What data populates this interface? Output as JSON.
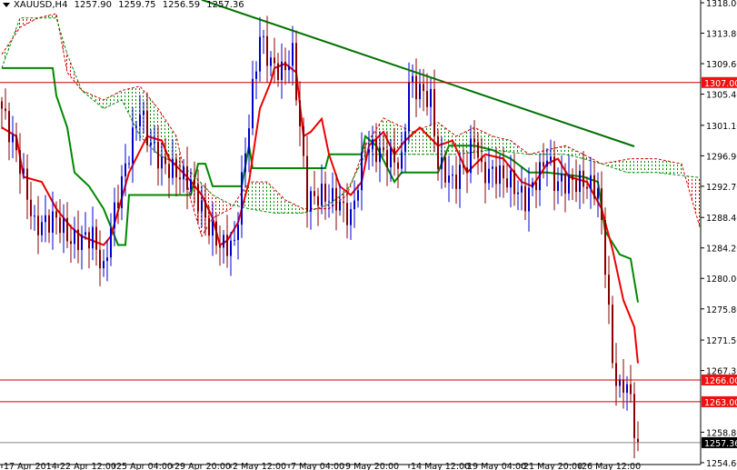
{
  "header": {
    "symbol": "XAUUSD,H4",
    "open": "1257.90",
    "high": "1259.75",
    "low": "1256.59",
    "close": "1257.36"
  },
  "colors": {
    "bull": "#0000cc",
    "bear": "#880000",
    "tenkan": "#ee0000",
    "kijun": "#008800",
    "spanA": "#d00000",
    "spanB": "#008800",
    "trend": "#007000",
    "level": "#cc0000",
    "label_bg": "#ee1111",
    "price_bg": "#000000"
  },
  "chart_data": {
    "type": "candlestick",
    "title": "XAUUSD,H4",
    "ylim": [
      1254.6,
      1318.0
    ],
    "bars": 176,
    "y_ticks": [
      "1318.00",
      "1313.80",
      "1309.60",
      "1305.40",
      "1301.10",
      "1296.90",
      "1292.70",
      "1288.40",
      "1284.20",
      "1280.00",
      "1275.80",
      "1271.50",
      "1267.30",
      "1258.80",
      "1254.60"
    ],
    "x_ticks": [
      {
        "bar": 0,
        "label": "17 Apr 2014"
      },
      {
        "bar": 15.5,
        "label": "22 Apr 12:00"
      },
      {
        "bar": 31,
        "label": "25 Apr 04:00"
      },
      {
        "bar": 47,
        "label": "29 Apr 20:00"
      },
      {
        "bar": 63,
        "label": "2 May 12:00"
      },
      {
        "bar": 79,
        "label": "7 May 04:00"
      },
      {
        "bar": 94,
        "label": "9 May 20:00"
      },
      {
        "bar": 112,
        "label": "14 May 12:00"
      },
      {
        "bar": 127.5,
        "label": "19 May 04:00"
      },
      {
        "bar": 143,
        "label": "21 May 20:00"
      },
      {
        "bar": 159,
        "label": "26 May 12:00"
      }
    ],
    "close_path": [
      [
        0,
        1303.4
      ],
      [
        5,
        1295.8
      ],
      [
        9,
        1287.1
      ],
      [
        15,
        1288.3
      ],
      [
        19,
        1285.2
      ],
      [
        25,
        1285.8
      ],
      [
        28,
        1280.8
      ],
      [
        30,
        1287.1
      ],
      [
        33,
        1293.3
      ],
      [
        38,
        1303.4
      ],
      [
        40,
        1299.6
      ],
      [
        44,
        1295.8
      ],
      [
        48,
        1294.6
      ],
      [
        52,
        1293.3
      ],
      [
        57,
        1287.1
      ],
      [
        60,
        1284.6
      ],
      [
        64,
        1284.6
      ],
      [
        66,
        1293.3
      ],
      [
        69,
        1305.9
      ],
      [
        71,
        1313.4
      ],
      [
        74,
        1309.6
      ],
      [
        77,
        1308.4
      ],
      [
        80,
        1310.9
      ],
      [
        82,
        1300.8
      ],
      [
        84,
        1290.8
      ],
      [
        88,
        1291.5
      ],
      [
        92,
        1290.8
      ],
      [
        96,
        1288.3
      ],
      [
        100,
        1298.3
      ],
      [
        105,
        1297.1
      ],
      [
        110,
        1295.8
      ],
      [
        112,
        1307.1
      ],
      [
        115,
        1305.9
      ],
      [
        118,
        1304.6
      ],
      [
        120,
        1295.8
      ],
      [
        124,
        1293.3
      ],
      [
        128,
        1295.8
      ],
      [
        130,
        1299.6
      ],
      [
        132,
        1294.6
      ],
      [
        136,
        1294.6
      ],
      [
        140,
        1293.3
      ],
      [
        144,
        1290.8
      ],
      [
        148,
        1294.6
      ],
      [
        150,
        1297.1
      ],
      [
        152,
        1293.3
      ],
      [
        156,
        1293.3
      ],
      [
        160,
        1293.3
      ],
      [
        164,
        1292.1
      ],
      [
        166,
        1282.1
      ],
      [
        168,
        1268.3
      ],
      [
        170,
        1264.5
      ],
      [
        172,
        1265.8
      ],
      [
        174,
        1259.5
      ],
      [
        175,
        1257.36
      ]
    ],
    "tenkan": [
      [
        0,
        1300.8
      ],
      [
        4,
        1299.6
      ],
      [
        6,
        1294
      ],
      [
        11,
        1293.3
      ],
      [
        15,
        1289.6
      ],
      [
        19,
        1287.1
      ],
      [
        22,
        1285.8
      ],
      [
        28,
        1284.6
      ],
      [
        30,
        1285.8
      ],
      [
        35,
        1294.6
      ],
      [
        40,
        1299.6
      ],
      [
        44,
        1299
      ],
      [
        46,
        1296.5
      ],
      [
        51,
        1294
      ],
      [
        55,
        1291.5
      ],
      [
        58,
        1288.3
      ],
      [
        60,
        1284.6
      ],
      [
        62,
        1285.2
      ],
      [
        65,
        1287.7
      ],
      [
        68,
        1293.3
      ],
      [
        71,
        1303.4
      ],
      [
        74,
        1307.1
      ],
      [
        75,
        1309
      ],
      [
        78,
        1309.6
      ],
      [
        81,
        1308.4
      ],
      [
        83,
        1299.6
      ],
      [
        85,
        1300.2
      ],
      [
        88,
        1302
      ],
      [
        90,
        1297.1
      ],
      [
        93,
        1292.7
      ],
      [
        96,
        1291.5
      ],
      [
        99,
        1293.3
      ],
      [
        101,
        1298.3
      ],
      [
        105,
        1300.2
      ],
      [
        108,
        1297.1
      ],
      [
        111,
        1299
      ],
      [
        115,
        1300.8
      ],
      [
        120,
        1298.3
      ],
      [
        124,
        1299
      ],
      [
        128,
        1294.6
      ],
      [
        133,
        1297.1
      ],
      [
        138,
        1296.5
      ],
      [
        143,
        1293.3
      ],
      [
        146,
        1292.7
      ],
      [
        150,
        1295.8
      ],
      [
        153,
        1296.5
      ],
      [
        156,
        1294
      ],
      [
        161,
        1293.3
      ],
      [
        165,
        1289.6
      ],
      [
        168,
        1284
      ],
      [
        171,
        1277
      ],
      [
        174,
        1273.3
      ],
      [
        175,
        1268.3
      ]
    ],
    "kijun": [
      [
        0,
        1309
      ],
      [
        14,
        1309
      ],
      [
        15,
        1305.2
      ],
      [
        18,
        1300.8
      ],
      [
        20,
        1294.6
      ],
      [
        24,
        1292.7
      ],
      [
        28,
        1289.6
      ],
      [
        32,
        1284.6
      ],
      [
        34,
        1284.6
      ],
      [
        35,
        1291.5
      ],
      [
        52,
        1291.5
      ],
      [
        54,
        1295.8
      ],
      [
        56,
        1295.8
      ],
      [
        58,
        1292.7
      ],
      [
        66,
        1292.7
      ],
      [
        68,
        1298.3
      ],
      [
        69,
        1295.2
      ],
      [
        89,
        1295.2
      ],
      [
        90,
        1297.1
      ],
      [
        99,
        1297.1
      ],
      [
        100,
        1299.6
      ],
      [
        103,
        1298.3
      ],
      [
        108,
        1293.3
      ],
      [
        110,
        1294.6
      ],
      [
        120,
        1294.6
      ],
      [
        123,
        1298.3
      ],
      [
        130,
        1298.3
      ],
      [
        135,
        1297.7
      ],
      [
        140,
        1296.5
      ],
      [
        145,
        1294.6
      ],
      [
        150,
        1294.6
      ],
      [
        160,
        1294
      ],
      [
        164,
        1293.3
      ],
      [
        166,
        1286.5
      ],
      [
        170,
        1283.3
      ],
      [
        173,
        1282.7
      ],
      [
        175,
        1276.7
      ]
    ],
    "span_a": [
      [
        0,
        1310.9
      ],
      [
        5,
        1314.6
      ],
      [
        10,
        1315.9
      ],
      [
        15,
        1316.5
      ],
      [
        18,
        1308.4
      ],
      [
        22,
        1305.9
      ],
      [
        28,
        1304.6
      ],
      [
        33,
        1305.9
      ],
      [
        38,
        1306.5
      ],
      [
        43,
        1303.4
      ],
      [
        48,
        1299.6
      ],
      [
        52,
        1290.8
      ],
      [
        55,
        1285.8
      ],
      [
        58,
        1288.3
      ],
      [
        63,
        1289.6
      ],
      [
        68,
        1293.3
      ],
      [
        73,
        1293.3
      ],
      [
        78,
        1290.8
      ],
      [
        83,
        1289.6
      ],
      [
        90,
        1289.6
      ],
      [
        95,
        1291.5
      ],
      [
        100,
        1298.3
      ],
      [
        105,
        1302.1
      ],
      [
        113,
        1300.2
      ],
      [
        120,
        1301.5
      ],
      [
        125,
        1299.6
      ],
      [
        130,
        1300.8
      ],
      [
        135,
        1299.6
      ],
      [
        140,
        1299
      ],
      [
        145,
        1297.1
      ],
      [
        150,
        1297.7
      ],
      [
        155,
        1298.3
      ],
      [
        160,
        1297.1
      ],
      [
        165,
        1295.8
      ],
      [
        173,
        1296.5
      ],
      [
        180,
        1296.5
      ],
      [
        187,
        1295.8
      ],
      [
        192,
        1287.1
      ]
    ],
    "span_b": [
      [
        0,
        1309
      ],
      [
        5,
        1315.9
      ],
      [
        15,
        1315.9
      ],
      [
        18,
        1310.9
      ],
      [
        22,
        1305.9
      ],
      [
        28,
        1303.4
      ],
      [
        33,
        1304.6
      ],
      [
        38,
        1299.6
      ],
      [
        43,
        1297.1
      ],
      [
        48,
        1295.8
      ],
      [
        52,
        1294.6
      ],
      [
        58,
        1291.5
      ],
      [
        63,
        1290.2
      ],
      [
        68,
        1289.6
      ],
      [
        75,
        1289
      ],
      [
        83,
        1289
      ],
      [
        90,
        1290.2
      ],
      [
        95,
        1292.1
      ],
      [
        100,
        1297.1
      ],
      [
        113,
        1297.1
      ],
      [
        125,
        1297.1
      ],
      [
        135,
        1297.7
      ],
      [
        145,
        1297.1
      ],
      [
        155,
        1297.1
      ],
      [
        160,
        1296.5
      ],
      [
        165,
        1295.8
      ],
      [
        172,
        1294.6
      ],
      [
        180,
        1294.6
      ],
      [
        192,
        1293.9
      ]
    ],
    "trendline": [
      [
        55,
        1318.4
      ],
      [
        174,
        1298.2
      ]
    ],
    "levels": [
      {
        "price": 1307.0,
        "label": "1307.00"
      },
      {
        "price": 1266.0,
        "label": "1266.00"
      },
      {
        "price": 1263.0,
        "label": "1263.00"
      }
    ],
    "current_price": {
      "price": 1257.36,
      "label": "1257.36"
    }
  }
}
